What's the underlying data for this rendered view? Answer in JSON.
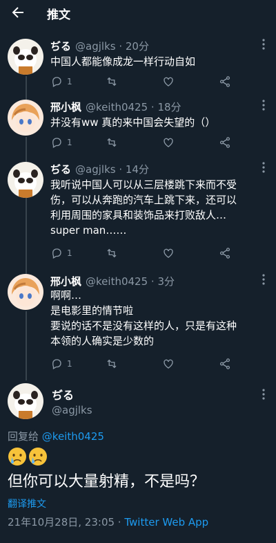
{
  "header": {
    "title": "推文",
    "back_icon": "arrow-left-icon"
  },
  "colors": {
    "background": "#15202b",
    "text": "#ffffff",
    "muted": "#8b98a5",
    "link": "#1d9bf0"
  },
  "tweets": [
    {
      "name": "ぢる",
      "handle": "@agjlks",
      "time": "20分",
      "lines": [
        "中国人都能像成龙一样行动自如"
      ],
      "reply_count": "1"
    },
    {
      "name": "邢小枫",
      "handle": "@keith0425",
      "time": "18分",
      "lines": [
        "并没有ww 真的来中国会失望的（）"
      ],
      "reply_count": "1"
    },
    {
      "name": "ぢる",
      "handle": "@agjlks",
      "time": "14分",
      "lines": [
        "我听说中国人可以从三层楼跳下来而不受",
        "伤，可以从奔跑的汽车上跳下来，还可以",
        "利用周围的家具和装饰品来打败敌人…",
        "super man……"
      ],
      "reply_count": "1"
    },
    {
      "name": "邢小枫",
      "handle": "@keith0425",
      "time": "3分",
      "lines": [
        "啊啊…",
        "是电影里的情节啦",
        "要说的话不是没有这样的人，只是有这种",
        "本领的人确实是少数的"
      ],
      "reply_count": "1"
    }
  ],
  "main_tweet": {
    "name": "ぢる",
    "handle": "@agjlks",
    "reply_prefix": "回复给",
    "reply_mention": "@keith0425",
    "emojis": [
      "crying-face-icon",
      "crying-face-icon"
    ],
    "text": "但你可以大量射精，不是吗？",
    "translate_label": "翻译推文",
    "timestamp": "21年10月28日, 23:05 · ",
    "source": "Twitter Web App"
  }
}
